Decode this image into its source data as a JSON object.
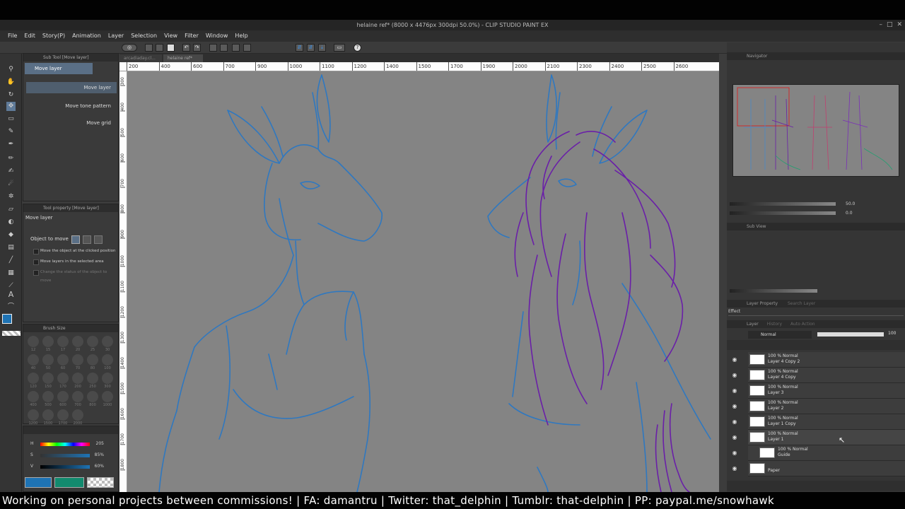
{
  "window": {
    "title": "helaine ref* (8000 x 4476px 300dpi 50.0%)  - CLIP STUDIO PAINT EX",
    "controls": [
      "–",
      "□",
      "✕"
    ]
  },
  "menu": [
    "File",
    "Edit",
    "Story(P)",
    "Animation",
    "Layer",
    "Selection",
    "View",
    "Filter",
    "Window",
    "Help"
  ],
  "tabs": [
    "arcadiaday.cl...",
    "helaine ref*"
  ],
  "ruler": {
    "h": [
      "200",
      "400",
      "600",
      "700",
      "900",
      "1000",
      "1100",
      "1200",
      "1400",
      "1500",
      "1700",
      "1900",
      "2000",
      "2100",
      "2300",
      "2400",
      "2500",
      "2600"
    ],
    "v": [
      "300",
      "400",
      "500",
      "600",
      "700",
      "800",
      "900",
      "1000",
      "1100",
      "1200",
      "1300",
      "1400",
      "1500",
      "1600",
      "1700",
      "1800"
    ]
  },
  "subtool": {
    "header": "Sub Tool [Move layer]",
    "selected": "Move layer",
    "items": [
      "Move layer",
      "Move tone pattern",
      "Move grid"
    ]
  },
  "toolprop": {
    "header": "Tool property [Move layer]",
    "title": "Move layer",
    "object_label": "Object to move",
    "options": [
      "Move the object at the clicked position",
      "Move layers in the selected area",
      "Change the status of the object to move"
    ]
  },
  "brushsize": {
    "header": "Brush Size",
    "sizes": [
      "12",
      "15",
      "17",
      "20",
      "25",
      "30",
      "40",
      "50",
      "60",
      "70",
      "80",
      "100",
      "120",
      "150",
      "170",
      "200",
      "250",
      "300",
      "400",
      "500",
      "600",
      "700",
      "800",
      "1000",
      "1200",
      "1500",
      "1700",
      "2000"
    ]
  },
  "color": {
    "h_label": "H",
    "s_label": "S",
    "v_label": "V",
    "h": "205",
    "s": "85%",
    "v": "60%",
    "main": "#1e73b4",
    "sub": "#128a6e"
  },
  "navigator": {
    "header": "Navigator",
    "zoom": "50.0",
    "angle": "0.0"
  },
  "subview": {
    "header": "Sub View"
  },
  "layerprop": {
    "header": "Layer Property",
    "search": "Search Layer",
    "effect": "Effect"
  },
  "layerpanel": {
    "tabs": [
      "Layer",
      "History",
      "Auto Action"
    ],
    "blend": "Normal",
    "opacity": "100",
    "layers": [
      {
        "mode": "100 % Normal",
        "name": "Layer 4 Copy 2"
      },
      {
        "mode": "100 % Normal",
        "name": "Layer 4 Copy"
      },
      {
        "mode": "100 % Normal",
        "name": "Layer 3"
      },
      {
        "mode": "100 % Normal",
        "name": "Layer 2"
      },
      {
        "mode": "100 % Normal",
        "name": "Layer 1 Copy"
      },
      {
        "mode": "100 % Normal",
        "name": "Layer 1"
      },
      {
        "mode": "100 % Normal",
        "name": "Guide"
      },
      {
        "mode": "",
        "name": "Paper"
      }
    ]
  },
  "banner": "Working on personal projects between commissions!  |   FA: damantru | Twitter: that_delphin | Tumblr: that-delphin | PP: paypal.me/snowhawk",
  "colors": {
    "sketch_blue": "#2f78c0",
    "sketch_purple": "#6a1fa8",
    "canvas_bg": "#848484"
  }
}
